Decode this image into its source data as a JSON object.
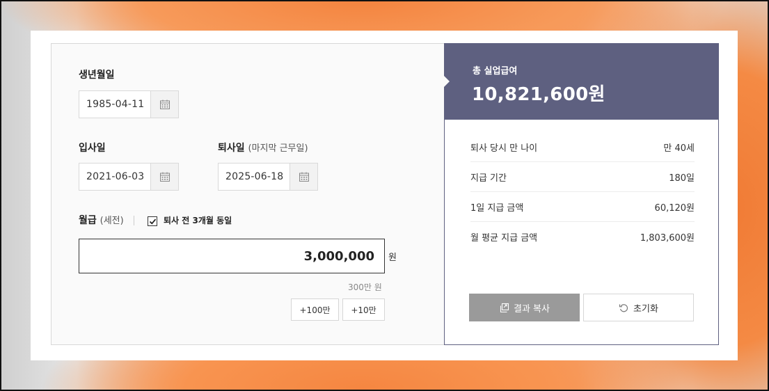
{
  "form": {
    "birth": {
      "label": "생년월일",
      "value": "1985-04-11",
      "icon": "calendar-icon"
    },
    "join": {
      "label": "입사일",
      "value": "2021-06-03",
      "icon": "calendar-icon"
    },
    "leave": {
      "label": "퇴사일",
      "sub_label": "(마지막 근무일)",
      "value": "2025-06-18",
      "icon": "calendar-icon"
    },
    "salary": {
      "label": "월급",
      "sub_label": "(세전)",
      "checkbox_label": "퇴사 전 3개월 동일",
      "checkbox_checked": true,
      "value": "3,000,000",
      "unit": "원",
      "helper": "300만 원",
      "buttons": [
        "+100만",
        "+10만"
      ]
    }
  },
  "result": {
    "total_label": "총 실업급여",
    "total_value": "10,821,600원",
    "rows": [
      {
        "label": "퇴사 당시 만 나이",
        "value": "만 40세"
      },
      {
        "label": "지급 기간",
        "value": "180일"
      },
      {
        "label": "1일 지급 금액",
        "value": "60,120원"
      },
      {
        "label": "월 평균 지급 금액",
        "value": "1,803,600원"
      }
    ],
    "copy_button": "결과 복사",
    "reset_button": "초기화",
    "accent_color": "#5e6080"
  }
}
